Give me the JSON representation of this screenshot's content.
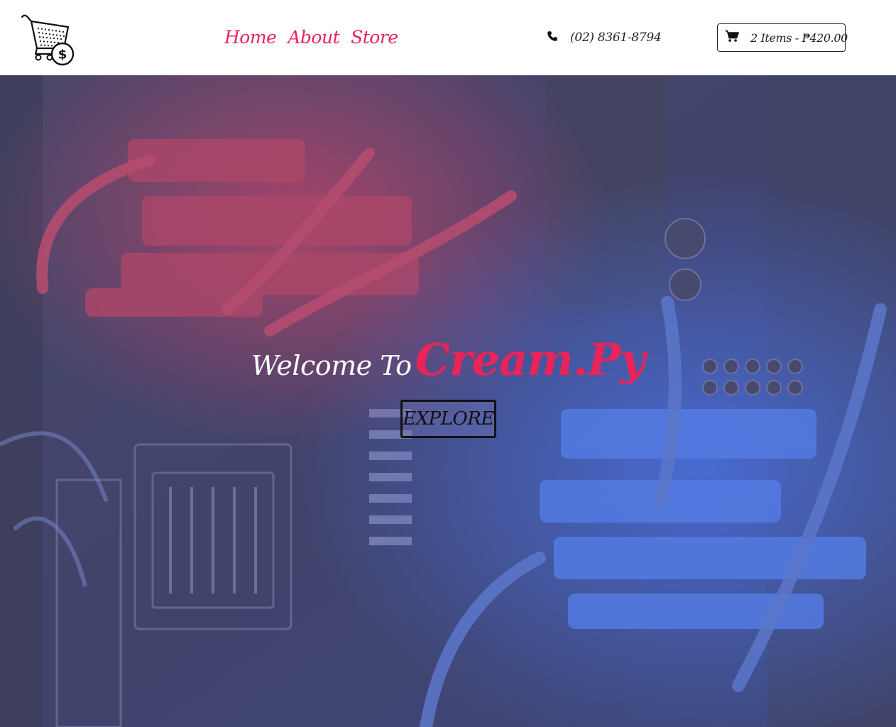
{
  "header": {
    "logo_icon": "shopping-cart-dollar-icon",
    "nav": [
      {
        "label": "Home"
      },
      {
        "label": "About"
      },
      {
        "label": "Store"
      }
    ],
    "phone": {
      "icon": "phone-icon",
      "number": "(02) 8361-8794"
    },
    "cart": {
      "icon": "cart-icon",
      "summary": "2 Items - ₱420.00"
    }
  },
  "hero": {
    "welcome_text": "Welcome To",
    "brand_text": "Cream.Py",
    "button_label": "EXPLORE",
    "background": "computer-hardware-watercooling-photo"
  },
  "colors": {
    "accent": "#e8245a",
    "text_dark": "#222222",
    "overlay": "#7878b4"
  }
}
